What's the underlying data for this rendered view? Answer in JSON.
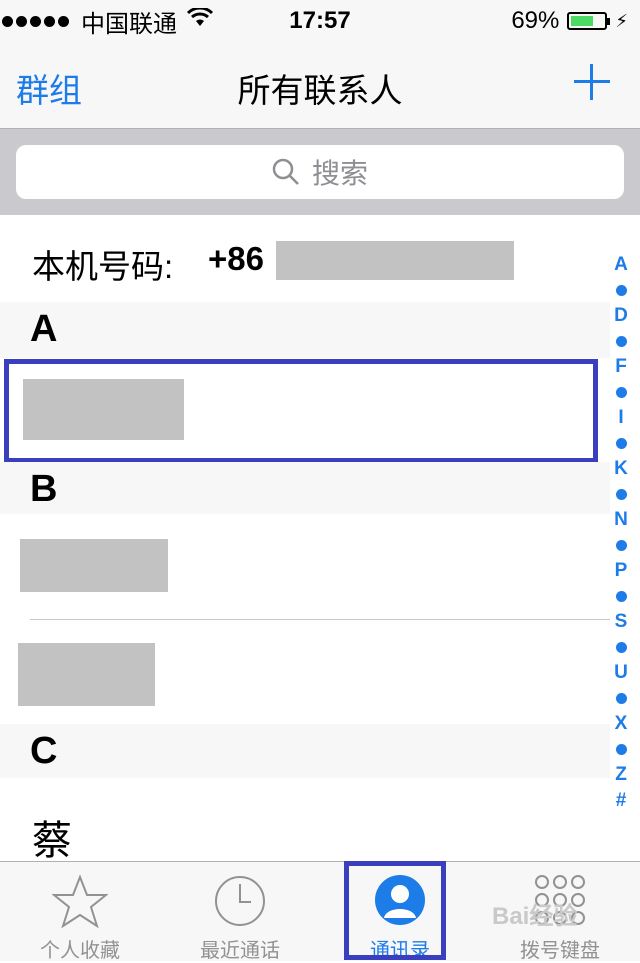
{
  "status_bar": {
    "carrier": "中国联通",
    "time": "17:57",
    "battery_percent": "69%",
    "battery_level": 0.69,
    "signal_bars": 5
  },
  "navbar": {
    "left_label": "群组",
    "title": "所有联系人",
    "add_icon": "plus-icon"
  },
  "search": {
    "placeholder": "搜索"
  },
  "my_number": {
    "label": "本机号码:",
    "prefix": "+86"
  },
  "sections": [
    {
      "letter": "A"
    },
    {
      "letter": "B"
    },
    {
      "letter": "C"
    }
  ],
  "contacts": {
    "c_first": "蔡"
  },
  "index": [
    "A",
    "D",
    "F",
    "I",
    "K",
    "N",
    "P",
    "S",
    "U",
    "X",
    "Z",
    "#"
  ],
  "tabs": [
    {
      "label": "个人收藏",
      "icon": "star-icon"
    },
    {
      "label": "最近通话",
      "icon": "clock-icon"
    },
    {
      "label": "通讯录",
      "icon": "contacts-icon"
    },
    {
      "label": "拨号键盘",
      "icon": "keypad-icon"
    }
  ],
  "colors": {
    "accent": "#1d7ce8",
    "highlight": "#3a3fbf",
    "redaction": "#c2c2c2",
    "battery": "#4cd964"
  },
  "watermark": "Bai经验"
}
